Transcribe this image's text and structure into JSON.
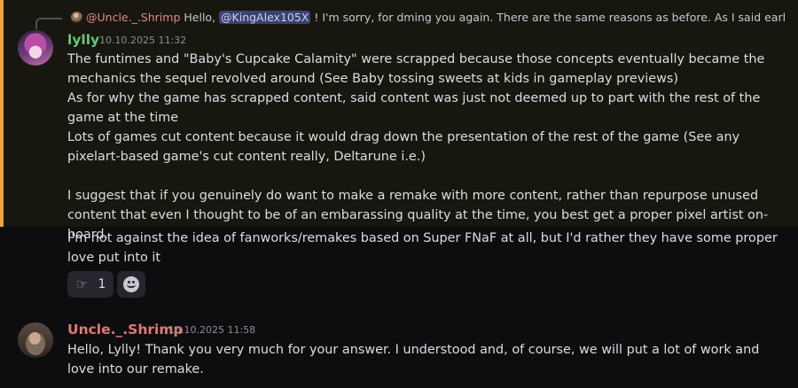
{
  "reply_preview": {
    "author": "@Uncle._.Shrimp",
    "text_before": "Hello, ",
    "mention": "@KingAlex105X",
    "text_after": " ! I'm sorry, for dming you again. There are the same reasons as before. As I said earlier, m..."
  },
  "messages": [
    {
      "author": "lylly",
      "timestamp": "10.10.2025 11:32",
      "author_color": "#68c47a",
      "paragraphs": [
        "The funtimes and \"Baby's Cupcake Calamity\" were scrapped because those concepts eventually became the mechanics the sequel revolved around (See Baby tossing sweets at kids in gameplay previews)",
        "As for why the game has scrapped content, said content was just not deemed up to part with the rest of the game at the time",
        "Lots of games cut content because it would drag down the presentation of the rest of the game (See any pixelart-based game's cut content really, Deltarune i.e.)",
        "",
        "I suggest that if you genuinely do want to make a remake with more content, rather than repurpose unused content that even I thought to be of an embarassing quality at the time, you best get a proper pixel artist on-board."
      ]
    },
    {
      "continuation": "I'm not against the idea of fanworks/remakes based on Super FNaF at all, but I'd rather they have some proper love put into it",
      "reactions": [
        {
          "icon": "thumbs-up-icon",
          "count": "1"
        },
        {
          "icon": "add-reaction-icon"
        }
      ]
    },
    {
      "author": "Uncle._.Shrimp",
      "timestamp": "10.10.2025 11:58",
      "author_color": "#e07a72",
      "text": "Hello, Lylly! Thank you very much for your answer. I understood and, of course, we will put a lot of work and love into our remake."
    }
  ],
  "colors": {
    "highlight_accent": "#e8a53a",
    "background": "#0d0d10",
    "mention_bg": "#3c4270"
  }
}
